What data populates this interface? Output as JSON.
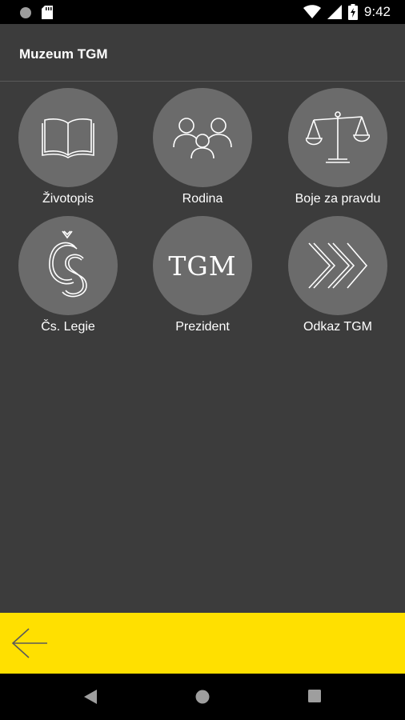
{
  "status_bar": {
    "time": "9:42",
    "icons": [
      "record-icon",
      "sd-card-icon",
      "wifi-icon",
      "signal-icon",
      "battery-charging-icon"
    ]
  },
  "app_bar": {
    "title": "Muzeum TGM"
  },
  "tiles": [
    {
      "label": "Životopis",
      "icon": "book-icon"
    },
    {
      "label": "Rodina",
      "icon": "family-icon"
    },
    {
      "label": "Boje za pravdu",
      "icon": "scales-icon"
    },
    {
      "label": "Čs. Legie",
      "icon": "cs-monogram-icon"
    },
    {
      "label": "Prezident",
      "icon": "tgm-text-icon",
      "icon_text": "TGM"
    },
    {
      "label": "Odkaz TGM",
      "icon": "chevrons-icon"
    }
  ],
  "bottom_bar": {
    "icon": "back-arrow-icon"
  },
  "nav_bar": {
    "icons": [
      "nav-back-icon",
      "nav-home-icon",
      "nav-recents-icon"
    ]
  },
  "colors": {
    "background": "#3c3c3c",
    "tile_circle": "#6b6b6b",
    "accent_yellow": "#ffe000",
    "status_bar": "#000000"
  }
}
